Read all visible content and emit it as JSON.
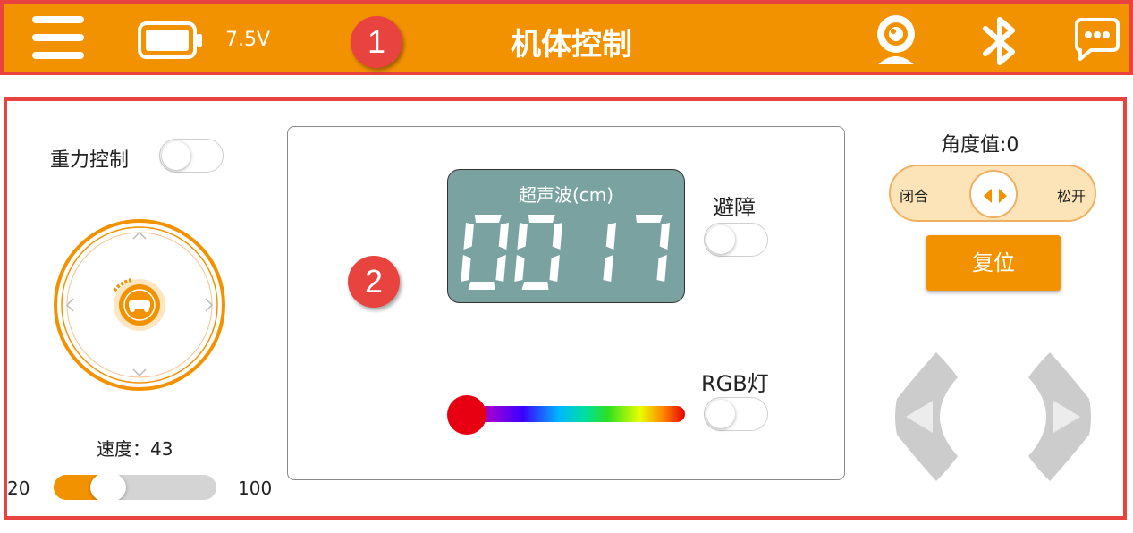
{
  "header": {
    "battery_voltage": "7.5V",
    "title": "机体控制",
    "marker": "1",
    "icons": [
      "menu-icon",
      "battery-icon",
      "camera-icon",
      "bluetooth-icon",
      "chat-icon"
    ],
    "background_color": "#f39200"
  },
  "main": {
    "marker": "2",
    "left": {
      "gravity_label": "重力控制",
      "gravity_on": false,
      "speed_label": "速度：43",
      "speed_value": 43,
      "speed_min": "20",
      "speed_max": "100"
    },
    "center": {
      "ultrasonic_label": "超声波(cm)",
      "ultrasonic_value": "0017",
      "avoid_label": "避障",
      "avoid_on": false,
      "rgb_label": "RGB灯",
      "rgb_on": false,
      "rgb_selected_color": "#e60012"
    },
    "right": {
      "angle_label": "角度值:0",
      "claw_close_label": "闭合",
      "claw_open_label": "松开",
      "reset_label": "复位"
    }
  },
  "colors": {
    "accent": "#f39200",
    "highlight_border": "#e8433f",
    "lcd_background": "#79a2a0",
    "arrow_pad": "#cccccc"
  }
}
